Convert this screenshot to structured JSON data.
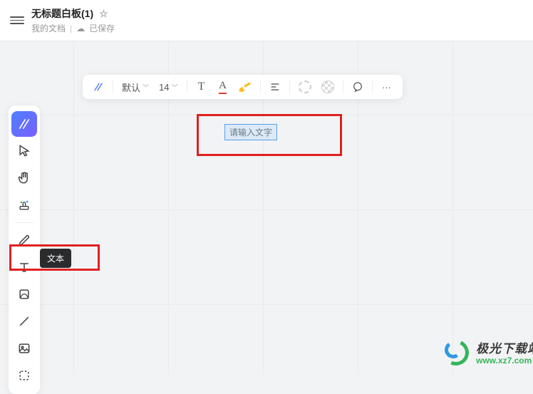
{
  "header": {
    "title": "无标题白板(1)",
    "breadcrumb": "我的文档",
    "save_status": "已保存"
  },
  "format_toolbar": {
    "font_name": "默认",
    "font_size": "14",
    "text_button": "T",
    "font_color_letter": "A",
    "more": "···"
  },
  "left_toolbar": {
    "tooltip_text": "文本"
  },
  "canvas": {
    "text_placeholder": "请输入文字"
  },
  "watermark": {
    "cn": "极光下载站",
    "en": "www.xz7.com"
  },
  "colors": {
    "accent": "#4876ff",
    "highlight_border": "#e02020",
    "font_color_underline": "#de3c36"
  }
}
